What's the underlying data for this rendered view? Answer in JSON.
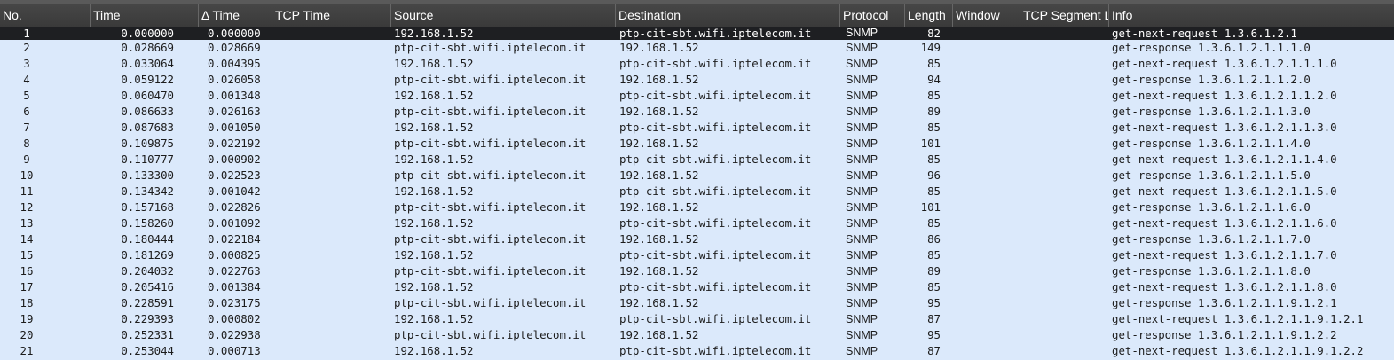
{
  "columns": [
    "No.",
    "Time",
    "Δ Time",
    "TCP Time",
    "Source",
    "Destination",
    "Protocol",
    "Length",
    "Window",
    "TCP Segment L",
    "Info"
  ],
  "packets": [
    {
      "no": "1",
      "time": "0.000000",
      "delta": "0.000000",
      "src": "192.168.1.52",
      "dst": "ptp-cit-sbt.wifi.iptelecom.it",
      "proto": "SNMP",
      "len": "82",
      "info": "get-next-request 1.3.6.1.2.1"
    },
    {
      "no": "2",
      "time": "0.028669",
      "delta": "0.028669",
      "src": "ptp-cit-sbt.wifi.iptelecom.it",
      "dst": "192.168.1.52",
      "proto": "SNMP",
      "len": "149",
      "info": "get-response 1.3.6.1.2.1.1.1.0"
    },
    {
      "no": "3",
      "time": "0.033064",
      "delta": "0.004395",
      "src": "192.168.1.52",
      "dst": "ptp-cit-sbt.wifi.iptelecom.it",
      "proto": "SNMP",
      "len": "85",
      "info": "get-next-request 1.3.6.1.2.1.1.1.0"
    },
    {
      "no": "4",
      "time": "0.059122",
      "delta": "0.026058",
      "src": "ptp-cit-sbt.wifi.iptelecom.it",
      "dst": "192.168.1.52",
      "proto": "SNMP",
      "len": "94",
      "info": "get-response 1.3.6.1.2.1.1.2.0"
    },
    {
      "no": "5",
      "time": "0.060470",
      "delta": "0.001348",
      "src": "192.168.1.52",
      "dst": "ptp-cit-sbt.wifi.iptelecom.it",
      "proto": "SNMP",
      "len": "85",
      "info": "get-next-request 1.3.6.1.2.1.1.2.0"
    },
    {
      "no": "6",
      "time": "0.086633",
      "delta": "0.026163",
      "src": "ptp-cit-sbt.wifi.iptelecom.it",
      "dst": "192.168.1.52",
      "proto": "SNMP",
      "len": "89",
      "info": "get-response 1.3.6.1.2.1.1.3.0"
    },
    {
      "no": "7",
      "time": "0.087683",
      "delta": "0.001050",
      "src": "192.168.1.52",
      "dst": "ptp-cit-sbt.wifi.iptelecom.it",
      "proto": "SNMP",
      "len": "85",
      "info": "get-next-request 1.3.6.1.2.1.1.3.0"
    },
    {
      "no": "8",
      "time": "0.109875",
      "delta": "0.022192",
      "src": "ptp-cit-sbt.wifi.iptelecom.it",
      "dst": "192.168.1.52",
      "proto": "SNMP",
      "len": "101",
      "info": "get-response 1.3.6.1.2.1.1.4.0"
    },
    {
      "no": "9",
      "time": "0.110777",
      "delta": "0.000902",
      "src": "192.168.1.52",
      "dst": "ptp-cit-sbt.wifi.iptelecom.it",
      "proto": "SNMP",
      "len": "85",
      "info": "get-next-request 1.3.6.1.2.1.1.4.0"
    },
    {
      "no": "10",
      "time": "0.133300",
      "delta": "0.022523",
      "src": "ptp-cit-sbt.wifi.iptelecom.it",
      "dst": "192.168.1.52",
      "proto": "SNMP",
      "len": "96",
      "info": "get-response 1.3.6.1.2.1.1.5.0"
    },
    {
      "no": "11",
      "time": "0.134342",
      "delta": "0.001042",
      "src": "192.168.1.52",
      "dst": "ptp-cit-sbt.wifi.iptelecom.it",
      "proto": "SNMP",
      "len": "85",
      "info": "get-next-request 1.3.6.1.2.1.1.5.0"
    },
    {
      "no": "12",
      "time": "0.157168",
      "delta": "0.022826",
      "src": "ptp-cit-sbt.wifi.iptelecom.it",
      "dst": "192.168.1.52",
      "proto": "SNMP",
      "len": "101",
      "info": "get-response 1.3.6.1.2.1.1.6.0"
    },
    {
      "no": "13",
      "time": "0.158260",
      "delta": "0.001092",
      "src": "192.168.1.52",
      "dst": "ptp-cit-sbt.wifi.iptelecom.it",
      "proto": "SNMP",
      "len": "85",
      "info": "get-next-request 1.3.6.1.2.1.1.6.0"
    },
    {
      "no": "14",
      "time": "0.180444",
      "delta": "0.022184",
      "src": "ptp-cit-sbt.wifi.iptelecom.it",
      "dst": "192.168.1.52",
      "proto": "SNMP",
      "len": "86",
      "info": "get-response 1.3.6.1.2.1.1.7.0"
    },
    {
      "no": "15",
      "time": "0.181269",
      "delta": "0.000825",
      "src": "192.168.1.52",
      "dst": "ptp-cit-sbt.wifi.iptelecom.it",
      "proto": "SNMP",
      "len": "85",
      "info": "get-next-request 1.3.6.1.2.1.1.7.0"
    },
    {
      "no": "16",
      "time": "0.204032",
      "delta": "0.022763",
      "src": "ptp-cit-sbt.wifi.iptelecom.it",
      "dst": "192.168.1.52",
      "proto": "SNMP",
      "len": "89",
      "info": "get-response 1.3.6.1.2.1.1.8.0"
    },
    {
      "no": "17",
      "time": "0.205416",
      "delta": "0.001384",
      "src": "192.168.1.52",
      "dst": "ptp-cit-sbt.wifi.iptelecom.it",
      "proto": "SNMP",
      "len": "85",
      "info": "get-next-request 1.3.6.1.2.1.1.8.0"
    },
    {
      "no": "18",
      "time": "0.228591",
      "delta": "0.023175",
      "src": "ptp-cit-sbt.wifi.iptelecom.it",
      "dst": "192.168.1.52",
      "proto": "SNMP",
      "len": "95",
      "info": "get-response 1.3.6.1.2.1.1.9.1.2.1"
    },
    {
      "no": "19",
      "time": "0.229393",
      "delta": "0.000802",
      "src": "192.168.1.52",
      "dst": "ptp-cit-sbt.wifi.iptelecom.it",
      "proto": "SNMP",
      "len": "87",
      "info": "get-next-request 1.3.6.1.2.1.1.9.1.2.1"
    },
    {
      "no": "20",
      "time": "0.252331",
      "delta": "0.022938",
      "src": "ptp-cit-sbt.wifi.iptelecom.it",
      "dst": "192.168.1.52",
      "proto": "SNMP",
      "len": "95",
      "info": "get-response 1.3.6.1.2.1.1.9.1.2.2"
    },
    {
      "no": "21",
      "time": "0.253044",
      "delta": "0.000713",
      "src": "192.168.1.52",
      "dst": "ptp-cit-sbt.wifi.iptelecom.it",
      "proto": "SNMP",
      "len": "87",
      "info": "get-next-request 1.3.6.1.2.1.1.9.1.2.2"
    }
  ],
  "selected_index": 0,
  "colors": {
    "header_bg": "#3f3f3f",
    "row_bg": "#dbe9fb",
    "selected_bg": "#1e1f22"
  }
}
